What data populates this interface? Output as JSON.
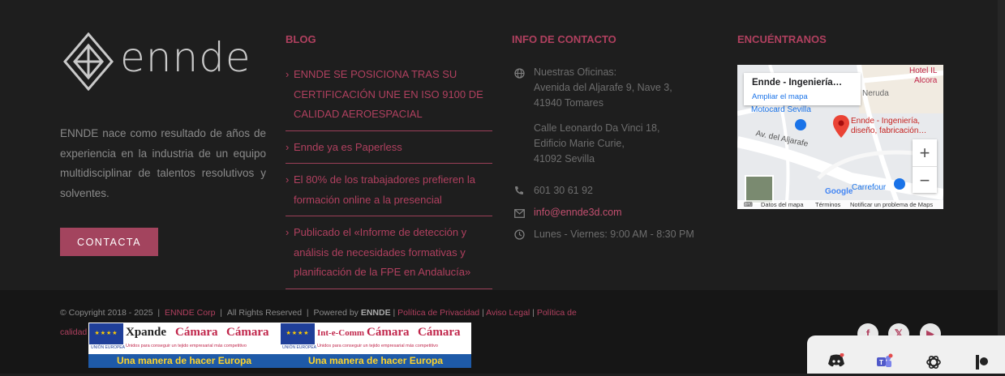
{
  "brand": {
    "name": "ennde"
  },
  "about": {
    "text": "ENNDE nace como resultado de años de experiencia en la industria de un equipo multidisciplinar de talentos resolutivos y solventes."
  },
  "contact_button": {
    "label": "CONTACTA"
  },
  "blog": {
    "title": "BLOG",
    "posts": [
      {
        "label": "ENNDE SE POSICIONA TRAS SU CERTIFICACIÓN UNE EN ISO 9100 DE CALIDAD AEROESPACIAL"
      },
      {
        "label": "Ennde ya es Paperless"
      },
      {
        "label": "El 80% de los trabajadores prefieren la formación online a la presencial"
      },
      {
        "label": "Publicado el «Informe de detección y análisis de necesidades formativas y planificación de la FPE en Andalucía»"
      }
    ]
  },
  "contact_info": {
    "title": "INFO DE CONTACTO",
    "office1": [
      "Nuestras Oficinas:",
      "Avenida del Aljarafe 9, Nave 3,",
      "41940 Tomares"
    ],
    "office2": [
      "Calle Leonardo Da Vinci 18,",
      "Edificio Marie Curie,",
      "41092 Sevilla"
    ],
    "phone": "601 30 61 92",
    "email": "info@ennde3d.com",
    "hours": "Lunes - Viernes: 9:00 AM - 8:30 PM"
  },
  "map_section": {
    "title": "ENCUÉNTRANOS",
    "card_title": "Ennde - Ingeniería…",
    "card_link": "Ampliar el mapa",
    "labels": {
      "hotel": "Hotel IL",
      "alcora": "Alcora",
      "neruda": "Neruda",
      "motocard": "Motocard Sevilla",
      "ennde": "Ennde - Ingeniería,",
      "ennde2": "diseño, fabricación…",
      "aljarafe": "Av. del Aljarafe",
      "carrefour": "Carrefour",
      "google": "Google"
    },
    "zoom_in": "+",
    "zoom_out": "−",
    "footer": [
      "Datos del mapa",
      "Términos",
      "Notificar un problema de Maps"
    ]
  },
  "copyright": {
    "prefix": "© Copyright 2018 - 2025",
    "sep": "|",
    "company_link": "ENNDE Corp",
    "rights": "All Rights Reserved",
    "powered_by": "Powered by",
    "powered_brand": "ENNDE",
    "privacy": "Política de Privacidad",
    "legal": "Aviso Legal",
    "quality": "Política de calidad"
  },
  "eu_banners": [
    {
      "program": "Xpande",
      "camara1": "Cámara",
      "camara2": "Cámara",
      "flag_label": "UNIÓN EUROPEA",
      "sub": "Unidos para conseguir un tejido empresarial más competitivo",
      "slogan": "Una manera de hacer Europa"
    },
    {
      "program": "Int-e-Comm",
      "camara1": "Cámara",
      "camara2": "Cámara",
      "flag_label": "UNIÓN EUROPEA",
      "sub": "Unidos para conseguir un tejido empresarial más competitivo",
      "slogan": "Una manera de hacer Europa"
    }
  ],
  "social": [
    "facebook-icon",
    "x-icon",
    "youtube-icon"
  ],
  "taskbar": [
    "discord-icon",
    "teams-icon",
    "openai-icon",
    "app-icon"
  ],
  "colors": {
    "accent": "#b0405f",
    "button": "#a3445e",
    "background": "#1e1e1e"
  }
}
